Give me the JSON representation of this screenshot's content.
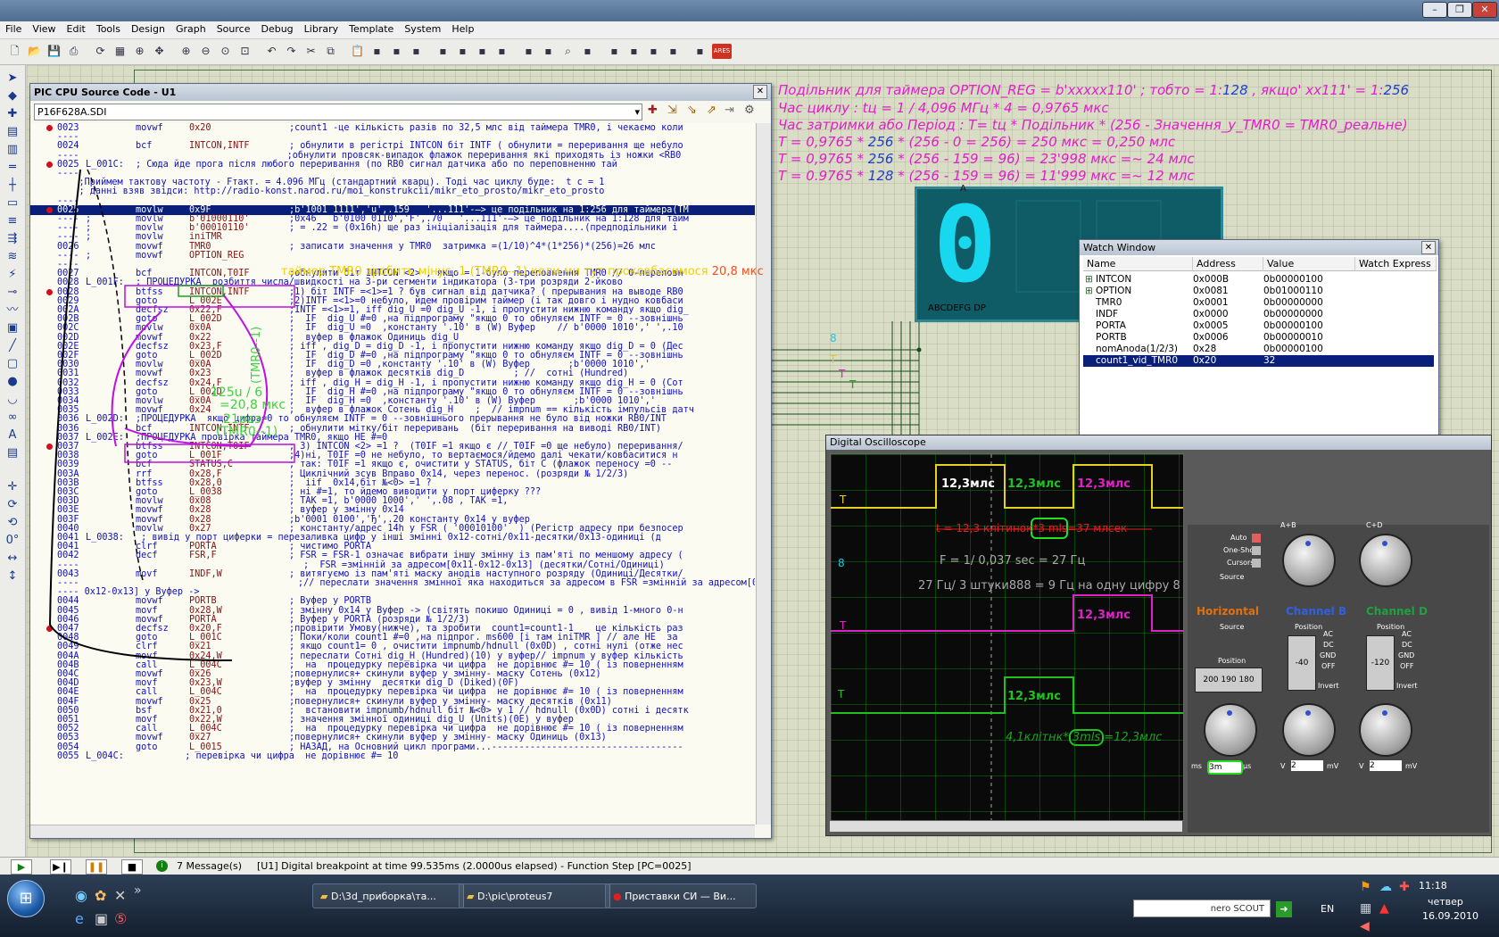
{
  "window_controls": {
    "minimize": "–",
    "restore": "❐",
    "close": "✕"
  },
  "menu": [
    "File",
    "View",
    "Edit",
    "Tools",
    "Design",
    "Graph",
    "Source",
    "Debug",
    "Library",
    "Template",
    "System",
    "Help"
  ],
  "toolbar_icons": [
    "new-icon",
    "open-icon",
    "save-icon",
    "print-icon",
    "refresh-icon",
    "grid-icon",
    "origin-icon",
    "pan-icon",
    "zoom-in-icon",
    "zoom-out-icon",
    "zoom-all-icon",
    "zoom-area-icon",
    "undo-icon",
    "redo-icon",
    "cut-icon",
    "copy-icon",
    "paste-icon",
    "block-copy-icon",
    "block-move-icon",
    "block-rotate-icon",
    "block-delete-icon",
    "pick-device-icon",
    "make-device-icon",
    "packaging-icon",
    "decompose-icon",
    "wire-autorouter-icon",
    "search-icon",
    "property-assign-icon",
    "new-sheet-icon",
    "remove-sheet-icon",
    "goto-sheet-icon",
    "bom-icon",
    "netlist-icon",
    "ares-icon"
  ],
  "toolbar": {
    "ares": "ARES"
  },
  "notes": {
    "line1_a": "Подільник для таймера OPTION_REG = b'xxxxx110'   ; тобто = 1:",
    "line1_b": "128",
    "line1_c": "  , якщо' xx111' = 1:",
    "line1_d": "256",
    "line2": "Час циклу :  tц = 1 / 4,096 МГц * 4 = 0,9765 мкс",
    "line3": "Час затримки або Період :     T= tц * Подільник * (256 - Значення_у_TMR0 = TMR0_реальне)",
    "line4_a": "T = 0,9765 * ",
    "line4_b": "256",
    "line4_c": " * (256 - 0 = 256) = 250 мкс = 0,250 млс",
    "line5_a": "T = 0,9765 * ",
    "line5_b": "256",
    "line5_c": " * (256 - 159 = 96) = 23'998 мкс =~ 24 млс",
    "line6_a": "T = 0.9765 * ",
    "line6_b": "128",
    "line6_c": " * (256 - 159 = 96) = 11'999 мкс =~ 12 млс"
  },
  "seg7": {
    "digit": "0",
    "pin_label_top": "A",
    "pins_label": "ABCDEFG  DP"
  },
  "source_window": {
    "title": "PIC CPU Source Code - U1",
    "file": "P16F628A.SDI",
    "lines": [
      {
        "bp": true,
        "addr": "0023",
        "label": "",
        "op": "movwf",
        "arg": "0x20",
        "cmt": ";count1 -це кількість разів по 32,5 млс від таймера TMR0, і чекаємо коли"
      },
      {
        "free": "----"
      },
      {
        "addr": "0024",
        "label": "",
        "op": "bcf",
        "arg": "INTCON,INTF",
        "cmt": "; обнулити в регістрі INTCON біт INTF ( обнулити = переривання ще небуло"
      },
      {
        "free": "----                                      ;обнулити провсяк-випадок флажок переривання які приходять із ножки <RB0"
      },
      {
        "bp": true,
        "addr": "0025",
        "label": "L_001C:",
        "op": "",
        "arg": "",
        "cmt": "",
        "free2": "; Сюда йде прога після любого переривання (по RB0 сигнал датчика або по переповненню тай"
      },
      {
        "free": "----"
      },
      {
        "free": "    ;Приймем тактову частоту - Fтакт. = 4.096 МГц (стандартний кварц). Тоді час циклу буде:  t с = 1"
      },
      {
        "free": "    ; данні взяв звідси: http://radio-konst.narod.ru/moi_konstrukcii/mikr_eto_prosto/mikr_eto_prosto"
      },
      {
        "free": "----"
      },
      {
        "hl": true,
        "bp": true,
        "addr": "0025",
        "label": "",
        "op": "movlw",
        "arg": "0x9F",
        "cmt": ";b'1001 1111','u',.159   '...111'-–> це подільник на 1:256 для таймера(TM"
      },
      {
        "addr": "----",
        "label": ";",
        "op": "movlw",
        "arg": "b'01000110'",
        "cmt": ";0x46   b'0100 0110','F',.70   '...111'-–> це подільник на 1:128 для тайм"
      },
      {
        "addr": "----",
        "label": ";",
        "op": "movlw",
        "arg": "b'00010110'",
        "cmt": "; = .22 = (0x16h) ще раз ініціалізація для таймера....(предподільники і"
      },
      {
        "addr": "----",
        "label": ";",
        "op": "movlw",
        "arg": "iniTMR",
        "cmt": ""
      },
      {
        "addr": "0026",
        "label": "",
        "op": "movwf",
        "arg": "TMR0",
        "cmt": "; записати значення у TMR0  затримка =(1/10)^4*(1*256)*(256)=26 млс"
      },
      {
        "addr": "----",
        "label": ";",
        "op": "movwf",
        "arg": "OPTION_REG",
        "cmt": ""
      },
      {
        "free": "----"
      },
      {
        "addr": "0027",
        "label": "",
        "op": "bcf",
        "arg": "INTCON,T0IF",
        "cmt": ";обнулити біт INTCON <2> , якщо = 1-було переповнення TMR0 // 0-переповн"
      },
      {
        "addr": "0028",
        "label": "L_001F:",
        "op": "",
        "arg": "",
        "cmt": "",
        "free2": "; ПРОЦЕДУРКА  розбиття числа/швидкості на 3-ри сегменти індикатора (3-три розряди 2-йково"
      },
      {
        "bp": true,
        "addr": "0028",
        "label": "",
        "op": "btfss",
        "arg": "INTCON,INTF",
        "cmt": ";1) біт INTF =<1>=1 ? був сигнал від датчика? ( прерывания на выводе RB0"
      },
      {
        "addr": "0029",
        "label": "",
        "op": "goto",
        "arg": "L_002E",
        "cmt": ";2)INTF =<1>=0 небуло, йдем провірим таймер (і так довго і нудно ковбаси"
      },
      {
        "addr": "002A",
        "label": "",
        "op": "decfsz",
        "arg": "0x22,F",
        "cmt": ";INTF =<1>=1, iff dig_U =0 dig_U -1, і пропустити нижню команду якщо dig_"
      },
      {
        "addr": "002B",
        "label": "",
        "op": "goto",
        "arg": "L_002D",
        "cmt": ";  IF  dig_U #=0 ,на підпрограму \"якщо 0 то обнуляєм INTF = 0 --зовнішнь"
      },
      {
        "addr": "002C",
        "label": "",
        "op": "movlw",
        "arg": "0x0A",
        "cmt": ";  IF  dig_U =0  ,константу '.10' в (W) Вуфер    // b'0000 1010',' ',.10"
      },
      {
        "addr": "002D",
        "label": "",
        "op": "movwf",
        "arg": "0x22",
        "cmt": ";  вуфер в флажок Одиниць dig_U"
      },
      {
        "addr": "002E",
        "label": "",
        "op": "decfsz",
        "arg": "0x23,F",
        "cmt": "; iff , dig_D = dig_D -1, і пропустити нижню команду якщо dig_D = 0 (Дес"
      },
      {
        "addr": "002F",
        "label": "",
        "op": "goto",
        "arg": "L_002D",
        "cmt": ";  IF  dig_D #=0 ,на підпрограму \"якщо 0 то обнуляєм INTF = 0 --зовнішнь"
      },
      {
        "addr": "0030",
        "label": "",
        "op": "movlw",
        "arg": "0x0A",
        "cmt": ";  IF  dig_D =0 ,константу '.10' в (W) Вуфер       ;b'0000 1010','"
      },
      {
        "addr": "0031",
        "label": "",
        "op": "movwf",
        "arg": "0x23",
        "cmt": ";  вуфер в флажок десятків dig_D         ; //  сотні (Hundred)"
      },
      {
        "addr": "0032",
        "label": "",
        "op": "decfsz",
        "arg": "0x24,F",
        "cmt": "; iff , dig_H = dig_H -1, і пропустити нижню команду якщо dig_H = 0 (Сот"
      },
      {
        "addr": "0033",
        "label": "",
        "op": "goto",
        "arg": "L_002D",
        "cmt": ";  IF  dig_H #=0 ,на підпрограму \"якщо 0 то обнуляєм INTF = 0 --зовнішнь"
      },
      {
        "addr": "0034",
        "label": "",
        "op": "movlw",
        "arg": "0x0A",
        "cmt": ";  IF  dig_H =0  ,константу '.10' в (W) Вуфер       ;b'0000 1010','"
      },
      {
        "addr": "0035",
        "label": "",
        "op": "movwf",
        "arg": "0x24",
        "cmt": ";  вуфер в флажок Сотень dig_H    ;  // impnum == кількість імпульсів датч"
      },
      {
        "addr": "0036",
        "label": "L_002D:",
        "op": "",
        "arg": "",
        "cmt": "",
        "free2": ";ПРОЦЕДУРКА  якщо цифра=0 то обнуляєм INTF = 0 --зовнішнього прерывання не було від ножки RB0/INT"
      },
      {
        "addr": "0036",
        "label": "",
        "op": "bcf",
        "arg": "INTCON,INTF",
        "cmt": "; обнулити мітку/біт переривань  (біт переривання на виводі RB0/INT)"
      },
      {
        "addr": "0037",
        "label": "L_002E:",
        "op": "",
        "arg": "",
        "cmt": "",
        "free2": ";ПРОЦЕДУРКА провірка таймера TMR0, якщо НЕ #=0"
      },
      {
        "bp": true,
        "addr": "0037",
        "label": "",
        "op": "btfss",
        "arg": "INTCON,T0IF",
        "cmt": "; 3) INTCON <2> =1 ?  (T0IF =1 якщо є // T0IF =0 ще небуло) переривання/"
      },
      {
        "addr": "0038",
        "label": "",
        "op": "goto",
        "arg": "L_001F",
        "cmt": ";4)ні, T0IF =0 не небуло, то вертаємося/йдемо далі чекати/ковбаситися н"
      },
      {
        "addr": "0039",
        "label": "",
        "op": "bcf",
        "arg": "STATUS,C",
        "cmt": "; так: T0IF =1 якщо є, очистити у STATUS, біт С (флажок переносу =0 --"
      },
      {
        "addr": "003A",
        "label": "",
        "op": "rrf",
        "arg": "0x28,F",
        "cmt": "; Циклічний зсув Вправо 0x14, через перенос. (розряди № 1/2/3)"
      },
      {
        "addr": "003B",
        "label": "",
        "op": "btfss",
        "arg": "0x28,0",
        "cmt": ";  iif  0x14,біт №<0> =1 ?"
      },
      {
        "addr": "003C",
        "label": "",
        "op": "goto",
        "arg": "L_0038",
        "cmt": "; ні #=1, то йдемо виводити у порт циферку ???"
      },
      {
        "addr": "003D",
        "label": "",
        "op": "movlw",
        "arg": "0x08",
        "cmt": "; ТАК =1, b'0000 1000',' ',.08 , ТАК =1,"
      },
      {
        "addr": "003E",
        "label": "",
        "op": "movwf",
        "arg": "0x28",
        "cmt": "; вуфер у змінну 0x14"
      },
      {
        "addr": "003F",
        "label": "",
        "op": "movwf",
        "arg": "0x28",
        "cmt": ";b'0001 0100','Ђ',.20 константу 0x14 у вуфер"
      },
      {
        "addr": "0040",
        "label": "",
        "op": "movlw",
        "arg": "0x27",
        "cmt": "; константу/адрес 14h у FSR ( '00010100'  ) (Регістр адресу при безпосер"
      },
      {
        "addr": "0041",
        "label": "L_0038:",
        "op": "",
        "arg": "",
        "cmt": "",
        "free2": " ; вивід у порт циферки = перезаливка цифр у інші змінні 0x12-сотні/0x11-десятки/0x13-одиниці (д"
      },
      {
        "addr": "0041",
        "label": "",
        "op": "clrf",
        "arg": "PORTA",
        "cmt": "; чистимо PORTA"
      },
      {
        "addr": "0042",
        "label": "",
        "op": "decf",
        "arg": "FSR,F",
        "cmt": "; FSR = FSR-1 означає вибрати іншу змінну із пам'яті по меншому адресу ("
      },
      {
        "free": "----                                         ;  FSR =змінній за адресом[0x11-0x12-0x13] (десятки/Сотні/Одиниці)"
      },
      {
        "addr": "0043",
        "label": "",
        "op": "movf",
        "arg": "INDF,W",
        "cmt": "; витягуємо із пам'яті маску анодів наступного розряду (Одиниці/Десятки/"
      },
      {
        "free": "----                                        ;// переслати значення змінної яка находиться за адресом в FSR =змінній за адресом[0x11-"
      },
      {
        "free": "---- 0x12-0x13] у Вуфер ->"
      },
      {
        "addr": "0044",
        "label": "",
        "op": "movwf",
        "arg": "PORTB",
        "cmt": "; Вуфер у PORTB"
      },
      {
        "addr": "0045",
        "label": "",
        "op": "movf",
        "arg": "0x28,W",
        "cmt": "; змінну 0x14 у Вуфер -> (світять покишо Одиниці = 0 , вивід 1-много 0-н"
      },
      {
        "addr": "0046",
        "label": "",
        "op": "movwf",
        "arg": "PORTA",
        "cmt": "; Вуфер у PORTA (розряди № 1/2/3)"
      },
      {
        "bp": true,
        "addr": "0047",
        "label": "",
        "op": "decfsz",
        "arg": "0x20,F",
        "cmt": ";провірити Умову(нижче), та зробити  count1=count1-1    це кількість раз"
      },
      {
        "addr": "0048",
        "label": "",
        "op": "goto",
        "arg": "L_001C",
        "cmt": "; Поки/коли count1 #=0 ,на підпрог. ms600 [і там iniTMR ] // але НЕ  за"
      },
      {
        "addr": "0049",
        "label": "",
        "op": "clrf",
        "arg": "0x21",
        "cmt": "; якщо count1= 0 , очистити impnumb/hdnull (0x0D) , сотні нулі (отже нес"
      },
      {
        "addr": "004A",
        "label": "",
        "op": "movf",
        "arg": "0x24,W",
        "cmt": "; переслати Сотні dig_H (Hundred)(10) у вуфер// impnum у вуфер кількість"
      },
      {
        "addr": "004B",
        "label": "",
        "op": "call",
        "arg": "L_004C",
        "cmt": ";  на  процедурку перевірка чи цифра  не дорівнює #= 10 ( із поверненням"
      },
      {
        "addr": "004C",
        "label": "",
        "op": "movwf",
        "arg": "0x26",
        "cmt": ";повернулися+ скинули вуфер у змінну- маску Сотень (0x12)"
      },
      {
        "addr": "004D",
        "label": "",
        "op": "movf",
        "arg": "0x23,W",
        "cmt": ";вуфер у змінну  десятки dig_D (Diked)(0F)"
      },
      {
        "addr": "004E",
        "label": "",
        "op": "call",
        "arg": "L_004C",
        "cmt": ";  на  процедурку перевірка чи цифра  не дорівнює #= 10 ( із поверненням"
      },
      {
        "addr": "004F",
        "label": "",
        "op": "movwf",
        "arg": "0x25",
        "cmt": ";повернулися+ скинули вуфер у змінну- маску десятків (0x11)"
      },
      {
        "addr": "0050",
        "label": "",
        "op": "bsf",
        "arg": "0x21,0",
        "cmt": ";  встановити impnumb/hdnull біт №<0> у 1 // hdnull (0x0D) сотні і десятк"
      },
      {
        "addr": "0051",
        "label": "",
        "op": "movf",
        "arg": "0x22,W",
        "cmt": "; значення змінної одиниці dig_U (Units)(0E) у вуфер"
      },
      {
        "addr": "0052",
        "label": "",
        "op": "call",
        "arg": "L_004C",
        "cmt": ";  на  процедурку перевірка чи цифра  не дорівнює #= 10 ( із поверненням"
      },
      {
        "addr": "0053",
        "label": "",
        "op": "movwf",
        "arg": "0x27",
        "cmt": ";повернулися+ скинули вуфер у змінну- маску Одиниць (0x13)"
      },
      {
        "addr": "0054",
        "label": "",
        "op": "goto",
        "arg": "L_0015",
        "cmt": "; НАЗАД, на Основний цикл програми...-----------------------------------"
      },
      {
        "addr": "0055",
        "label": "L_004C:",
        "op": "",
        "arg": "",
        "cmt": "",
        "free2": "         ; перевірка чи цифра  не дорівнює #= 10"
      }
    ]
  },
  "annotations": {
    "timer_note": "таймер TMR0 зробить мінус -1  (TMR0--1) коли ми тут проковбасимося ",
    "timer_value": "20,8 мкс",
    "a1": "125u / 6",
    "a2": "=20,8 мкс",
    "a3": "21раз",
    "a4": "(TMR0--1)",
    "a5": "(TMR0--1)"
  },
  "watch": {
    "title": "Watch Window",
    "headers": [
      "Name",
      "Address",
      "Value",
      "Watch Express"
    ],
    "rows": [
      {
        "name": "INTCON",
        "addr": "0x000B",
        "val": "0b00000100",
        "exp": true
      },
      {
        "name": "OPTION",
        "addr": "0x0081",
        "val": "0b01000110",
        "exp": true
      },
      {
        "name": "TMR0",
        "addr": "0x0001",
        "val": "0b00000000"
      },
      {
        "name": "INDF",
        "addr": "0x0000",
        "val": "0b00000000"
      },
      {
        "name": "PORTA",
        "addr": "0x0005",
        "val": "0b00000100"
      },
      {
        "name": "PORTB",
        "addr": "0x0006",
        "val": "0b00000010"
      },
      {
        "name": "nomAnoda(1/2/3)",
        "addr": "0x28",
        "val": "0b00000100"
      },
      {
        "name": "count1_vid_TMR0",
        "addr": "0x20",
        "val": "32",
        "sel": true
      }
    ]
  },
  "osc": {
    "title": "Digital Oscilloscope",
    "p1": "12,3млс",
    "p2": "12,3млс",
    "p3": "12,3млс",
    "p4": "12,3млс",
    "p5": "12,3млс",
    "t_formula_a": "t = 12,3 клітинок*",
    "t_formula_b": "3 mls",
    "t_formula_c": "=37 млсек",
    "freq": "F =    1/ 0,037 sec = 27 Гц",
    "per_digit": "27 Гц/ 3 штуки888 = 9 Гц на одну цифру 8",
    "cells_a": "4,1клітнк*",
    "cells_b": "3mls",
    "cells_c": "=12,3млс",
    "ch_T": "T",
    "ch_8": "8",
    "auto": "Auto",
    "oneshot": "One-Shot",
    "cursors": "Cursors",
    "source": "Source",
    "position": "Position",
    "horizontal": "Horizontal",
    "channel_b": "Channel B",
    "channel_d": "Channel D",
    "ab": "A+B",
    "cd": "C+D",
    "ac": "AC",
    "dc": "DC",
    "gnd": "GND",
    "off": "OFF",
    "invert": "Invert",
    "pos_vals": "200 190 180",
    "pos_b": "-40",
    "pos_d": "-120",
    "ms": "ms",
    "us": "μs",
    "v": "V",
    "mv": "mV",
    "time_val": "3m",
    "volt_b": "2",
    "volt_d": "2",
    "volt_b2": "2",
    "volt_d2": "2"
  },
  "schematic_labels": {
    "s8": "8",
    "sT": "T",
    "sT2": "T",
    "sT3": "T"
  },
  "status": {
    "messages": "7 Message(s)",
    "text": "[U1] Digital breakpoint at time 99.535ms (2.0000us elapsed) - Function Step [PC=0025]"
  },
  "taskbar": {
    "tasks": [
      "D:\\3d_приборка\\та...",
      "D:\\pic\\proteus7",
      "Приставки СИ — Ви..."
    ],
    "nero": "nero SCOUT",
    "lang": "EN",
    "time": "11:18",
    "day": "четвер",
    "date": "16.09.2010"
  }
}
